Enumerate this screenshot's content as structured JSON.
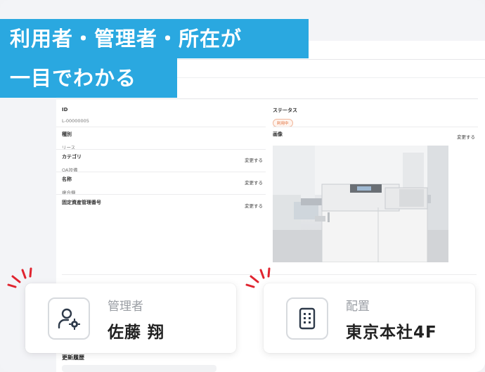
{
  "banner": {
    "line1": "利用者・管理者・所在が",
    "line2": "一目でわかる"
  },
  "fields": {
    "id": {
      "label": "ID",
      "value": "L-00000005"
    },
    "kind": {
      "label": "種別",
      "value": "リース"
    },
    "category": {
      "label": "カテゴリ",
      "value": "OA設備",
      "action": "変更する"
    },
    "name": {
      "label": "名称",
      "value": "複合機",
      "action": "変更する"
    },
    "asset_no": {
      "label": "固定資産管理番号",
      "action": "変更する"
    },
    "status": {
      "label": "ステータス",
      "value": "利用中"
    },
    "image": {
      "label": "画像",
      "action": "変更する"
    }
  },
  "cards": {
    "manager": {
      "label": "管理者",
      "value": "佐藤 翔",
      "icon": "user-gear-icon"
    },
    "location": {
      "label": "配置",
      "value": "東京本社4F",
      "icon": "building-icon"
    }
  },
  "history": {
    "title": "更新履歴"
  },
  "colors": {
    "accent": "#2aa8e0",
    "status": "#e06d3a",
    "burst": "#e0242f"
  }
}
